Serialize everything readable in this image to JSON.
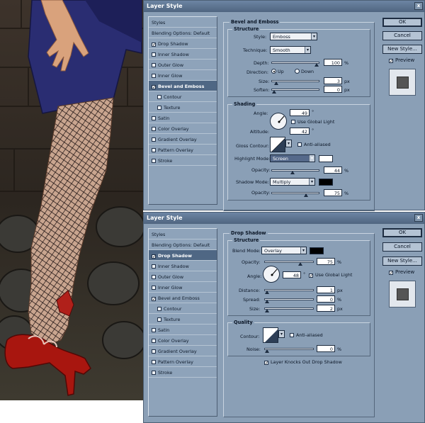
{
  "dialog1": {
    "title": "Layer Style",
    "buttons": {
      "ok": "OK",
      "cancel": "Cancel",
      "new_style": "New Style...",
      "preview": "Preview"
    },
    "styles_list": [
      {
        "label": "Styles",
        "checkbox": false,
        "checked": false,
        "selected": false,
        "sub": false
      },
      {
        "label": "Blending Options: Default",
        "checkbox": false,
        "checked": false,
        "selected": false,
        "sub": false
      },
      {
        "label": "Drop Shadow",
        "checkbox": true,
        "checked": true,
        "selected": false,
        "sub": false
      },
      {
        "label": "Inner Shadow",
        "checkbox": true,
        "checked": false,
        "selected": false,
        "sub": false
      },
      {
        "label": "Outer Glow",
        "checkbox": true,
        "checked": false,
        "selected": false,
        "sub": false
      },
      {
        "label": "Inner Glow",
        "checkbox": true,
        "checked": false,
        "selected": false,
        "sub": false
      },
      {
        "label": "Bevel and Emboss",
        "checkbox": true,
        "checked": true,
        "selected": true,
        "sub": false
      },
      {
        "label": "Contour",
        "checkbox": true,
        "checked": false,
        "selected": false,
        "sub": true
      },
      {
        "label": "Texture",
        "checkbox": true,
        "checked": false,
        "selected": false,
        "sub": true
      },
      {
        "label": "Satin",
        "checkbox": true,
        "checked": false,
        "selected": false,
        "sub": false
      },
      {
        "label": "Color Overlay",
        "checkbox": true,
        "checked": false,
        "selected": false,
        "sub": false
      },
      {
        "label": "Gradient Overlay",
        "checkbox": true,
        "checked": false,
        "selected": false,
        "sub": false
      },
      {
        "label": "Pattern Overlay",
        "checkbox": true,
        "checked": false,
        "selected": false,
        "sub": false
      },
      {
        "label": "Stroke",
        "checkbox": true,
        "checked": false,
        "selected": false,
        "sub": false
      }
    ],
    "section_title": "Bevel and Emboss",
    "structure": {
      "title": "Structure",
      "style_label": "Style:",
      "style_value": "Emboss",
      "technique_label": "Technique:",
      "technique_value": "Smooth",
      "depth_label": "Depth:",
      "depth_value": "100",
      "depth_unit": "%",
      "depth_fraction": 1.0,
      "direction_label": "Direction:",
      "dir_up": "Up",
      "dir_down": "Down",
      "size_label": "Size:",
      "size_value": "3",
      "size_unit": "px",
      "size_fraction": 0.05,
      "soften_label": "Soften:",
      "soften_value": "0",
      "soften_unit": "px",
      "soften_fraction": 0.0
    },
    "shading": {
      "title": "Shading",
      "angle_label": "Angle:",
      "angle_value": "49",
      "angle_unit": "°",
      "use_global_light": "Use Global Light",
      "altitude_label": "Altitude:",
      "altitude_value": "42",
      "altitude_unit": "°",
      "gloss_contour_label": "Gloss Contour:",
      "anti_aliased": "Anti-aliased",
      "highlight_mode_label": "Highlight Mode:",
      "highlight_mode_value": "Screen",
      "highlight_color": "#ffffff",
      "hl_opacity_label": "Opacity:",
      "hl_opacity_value": "44",
      "hl_opacity_unit": "%",
      "hl_opacity_fraction": 0.44,
      "shadow_mode_label": "Shadow Mode:",
      "shadow_mode_value": "Multiply",
      "shadow_color": "#000000",
      "sh_opacity_label": "Opacity:",
      "sh_opacity_value": "75",
      "sh_opacity_unit": "%",
      "sh_opacity_fraction": 0.75
    }
  },
  "dialog2": {
    "title": "Layer Style",
    "buttons": {
      "ok": "OK",
      "cancel": "Cancel",
      "new_style": "New Style...",
      "preview": "Preview"
    },
    "styles_list": [
      {
        "label": "Styles",
        "checkbox": false,
        "checked": false,
        "selected": false,
        "sub": false
      },
      {
        "label": "Blending Options: Default",
        "checkbox": false,
        "checked": false,
        "selected": false,
        "sub": false
      },
      {
        "label": "Drop Shadow",
        "checkbox": true,
        "checked": true,
        "selected": true,
        "sub": false
      },
      {
        "label": "Inner Shadow",
        "checkbox": true,
        "checked": false,
        "selected": false,
        "sub": false
      },
      {
        "label": "Outer Glow",
        "checkbox": true,
        "checked": false,
        "selected": false,
        "sub": false
      },
      {
        "label": "Inner Glow",
        "checkbox": true,
        "checked": false,
        "selected": false,
        "sub": false
      },
      {
        "label": "Bevel and Emboss",
        "checkbox": true,
        "checked": true,
        "selected": false,
        "sub": false
      },
      {
        "label": "Contour",
        "checkbox": true,
        "checked": false,
        "selected": false,
        "sub": true
      },
      {
        "label": "Texture",
        "checkbox": true,
        "checked": false,
        "selected": false,
        "sub": true
      },
      {
        "label": "Satin",
        "checkbox": true,
        "checked": false,
        "selected": false,
        "sub": false
      },
      {
        "label": "Color Overlay",
        "checkbox": true,
        "checked": false,
        "selected": false,
        "sub": false
      },
      {
        "label": "Gradient Overlay",
        "checkbox": true,
        "checked": false,
        "selected": false,
        "sub": false
      },
      {
        "label": "Pattern Overlay",
        "checkbox": true,
        "checked": false,
        "selected": false,
        "sub": false
      },
      {
        "label": "Stroke",
        "checkbox": true,
        "checked": false,
        "selected": false,
        "sub": false
      }
    ],
    "section_title": "Drop Shadow",
    "structure": {
      "title": "Structure",
      "blend_mode_label": "Blend Mode:",
      "blend_mode_value": "Overlay",
      "shadow_color": "#000000",
      "opacity_label": "Opacity:",
      "opacity_value": "75",
      "opacity_unit": "%",
      "opacity_fraction": 0.75,
      "angle_label": "Angle:",
      "angle_value": "48",
      "angle_unit": "°",
      "use_global_light": "Use Global Light",
      "distance_label": "Distance:",
      "distance_value": "1",
      "distance_unit": "px",
      "distance_fraction": 0.0,
      "spread_label": "Spread:",
      "spread_value": "0",
      "spread_unit": "%",
      "spread_fraction": 0.0,
      "size_label": "Size:",
      "size_value": "2",
      "size_unit": "px",
      "size_fraction": 0.0
    },
    "quality": {
      "title": "Quality",
      "contour_label": "Contour:",
      "anti_aliased": "Anti-aliased",
      "noise_label": "Noise:",
      "noise_value": "0",
      "noise_unit": "%",
      "noise_fraction": 0.0
    },
    "knockout_label": "Layer Knocks Out Drop Shadow"
  },
  "photo": {
    "description_icon": "leg-photo"
  }
}
